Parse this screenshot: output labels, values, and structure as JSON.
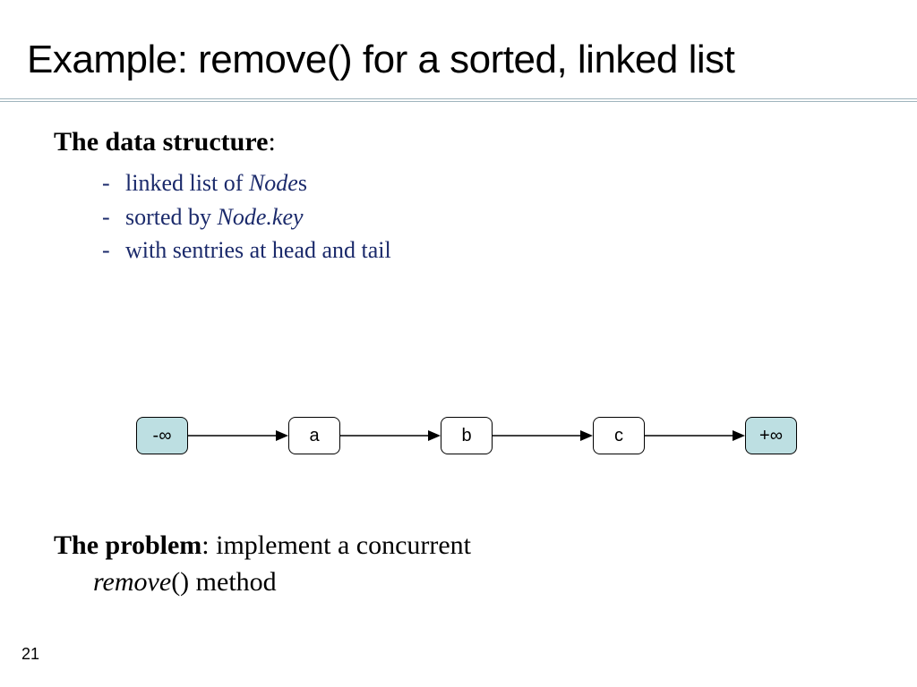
{
  "title": "Example: remove() for a sorted, linked list",
  "section1": {
    "heading_bold": "The data structure",
    "heading_rest": ":",
    "bullets": [
      {
        "pre": "linked list of ",
        "em": "Node",
        "post": "s"
      },
      {
        "pre": "sorted by ",
        "em": "Node.key",
        "post": ""
      },
      {
        "pre": "with sentries at head and tail",
        "em": "",
        "post": ""
      }
    ]
  },
  "diagram": {
    "nodes": [
      "-∞",
      "a",
      "b",
      "c",
      "+∞"
    ]
  },
  "section2": {
    "heading_bold": "The problem",
    "heading_rest": ": implement a concurrent",
    "line2_em": "remove",
    "line2_post": "() method"
  },
  "page_number": "21"
}
